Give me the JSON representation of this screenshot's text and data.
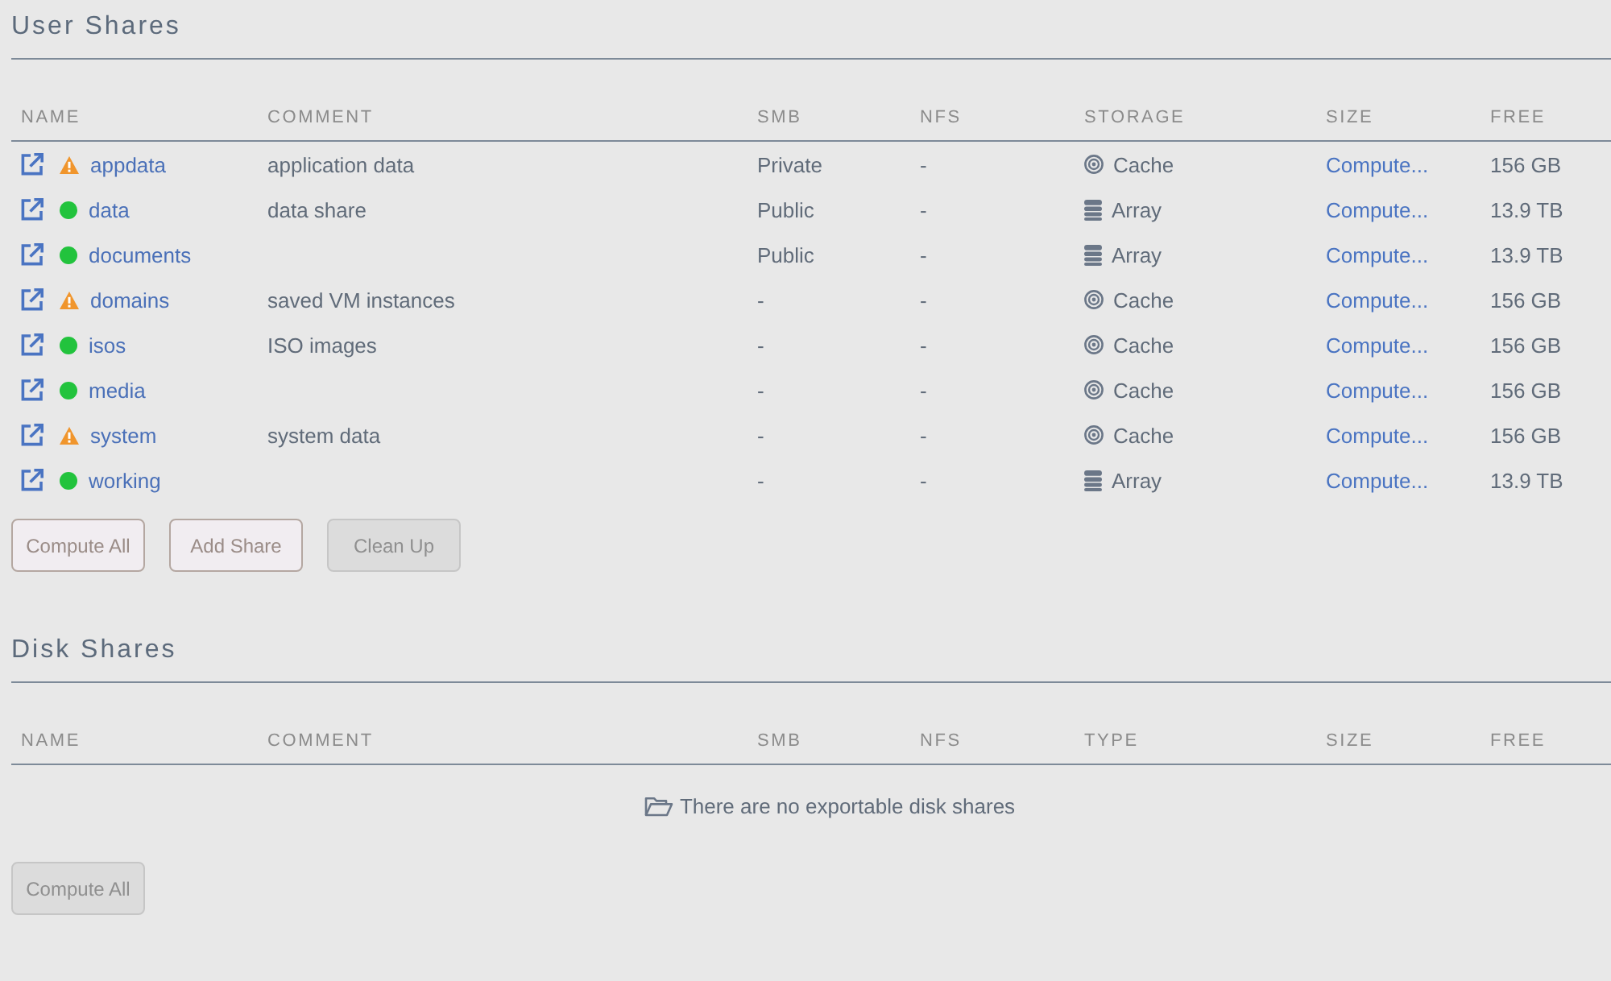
{
  "sections": [
    {
      "title": "User Shares",
      "table": {
        "columns": [
          "NAME",
          "COMMENT",
          "SMB",
          "NFS",
          "STORAGE",
          "SIZE",
          "FREE"
        ],
        "rows": [
          {
            "name": "appdata",
            "kind": "warning",
            "comment": "application data",
            "smb": "Private",
            "nfs": "-",
            "storage": {
              "kind": "cache",
              "label": "Cache"
            },
            "size": "Compute...",
            "free": "156 GB"
          },
          {
            "name": "data",
            "kind": "ok",
            "comment": "data share",
            "smb": "Public",
            "nfs": "-",
            "storage": {
              "kind": "array",
              "label": "Array"
            },
            "size": "Compute...",
            "free": "13.9 TB"
          },
          {
            "name": "documents",
            "kind": "ok",
            "smb": "Public",
            "nfs": "-",
            "storage": {
              "kind": "array",
              "label": "Array"
            },
            "size": "Compute...",
            "free": "13.9 TB"
          },
          {
            "name": "domains",
            "kind": "warning",
            "comment": "saved VM instances",
            "smb": "-",
            "nfs": "-",
            "storage": {
              "kind": "cache",
              "label": "Cache"
            },
            "size": "Compute...",
            "free": "156 GB"
          },
          {
            "name": "isos",
            "kind": "ok",
            "comment": "ISO images",
            "smb": "-",
            "nfs": "-",
            "storage": {
              "kind": "cache",
              "label": "Cache"
            },
            "size": "Compute...",
            "free": "156 GB"
          },
          {
            "name": "media",
            "kind": "ok",
            "smb": "-",
            "nfs": "-",
            "storage": {
              "kind": "cache",
              "label": "Cache"
            },
            "size": "Compute...",
            "free": "156 GB"
          },
          {
            "name": "system",
            "kind": "warning",
            "comment": "system data",
            "smb": "-",
            "nfs": "-",
            "storage": {
              "kind": "cache",
              "label": "Cache"
            },
            "size": "Compute...",
            "free": "156 GB"
          },
          {
            "name": "working",
            "kind": "ok",
            "smb": "-",
            "nfs": "-",
            "storage": {
              "kind": "array",
              "label": "Array"
            },
            "size": "Compute...",
            "free": "13.9 TB"
          }
        ]
      },
      "buttons": [
        {
          "label": "Compute All",
          "disabled": false
        },
        {
          "label": "Add Share",
          "disabled": false
        },
        {
          "label": "Clean Up",
          "disabled": true
        }
      ]
    },
    {
      "title": "Disk Shares",
      "table": {
        "columns": [
          "NAME",
          "COMMENT",
          "SMB",
          "NFS",
          "TYPE",
          "SIZE",
          "FREE"
        ],
        "empty_message": "There are no exportable disk shares"
      },
      "buttons": [
        {
          "label": "Compute All",
          "disabled": true
        }
      ]
    }
  ]
}
